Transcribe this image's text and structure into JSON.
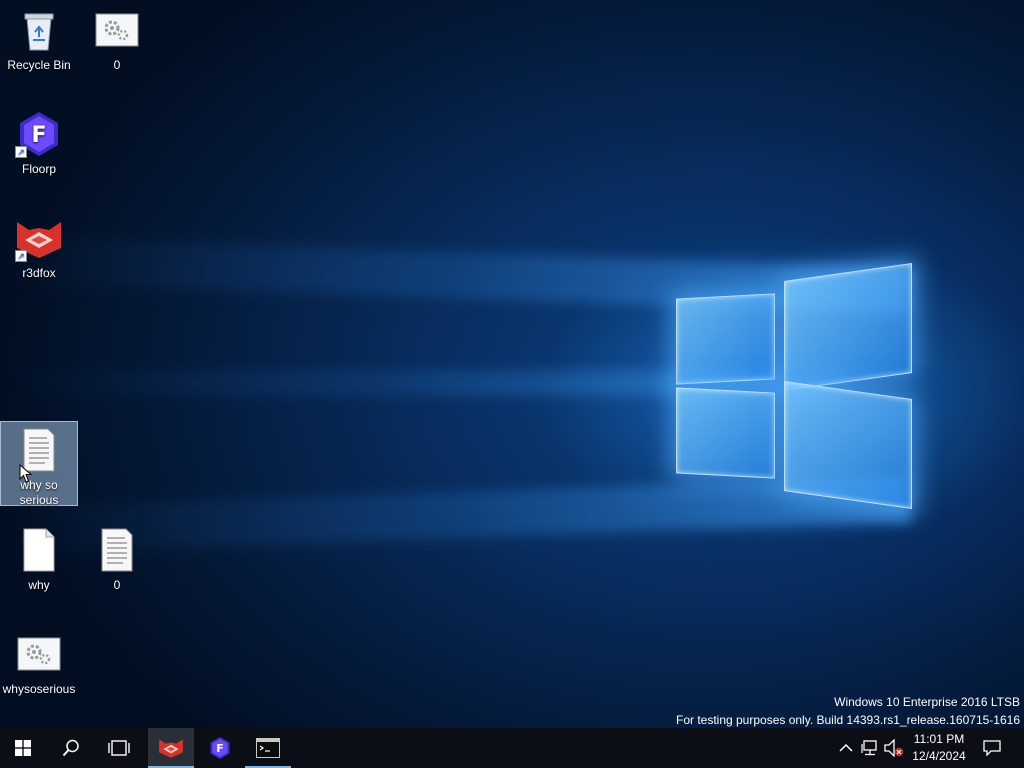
{
  "desktop": {
    "icons": [
      {
        "label": "Recycle Bin",
        "icon": "recycle-bin-icon"
      },
      {
        "label": "0",
        "icon": "settings-file-icon"
      },
      {
        "label": "Floorp",
        "icon": "floorp-icon",
        "shortcut": true
      },
      {
        "label": "r3dfox",
        "icon": "r3dfox-icon",
        "shortcut": true
      },
      {
        "label": "why so serious",
        "icon": "text-document-icon",
        "selected": true
      },
      {
        "label": "why",
        "icon": "blank-file-icon"
      },
      {
        "label": "0",
        "icon": "text-document-icon"
      },
      {
        "label": "whysoserious",
        "icon": "settings-file-icon"
      }
    ],
    "watermark": {
      "line1": "Windows 10 Enterprise 2016 LTSB",
      "line2": "For testing purposes only. Build 14393.rs1_release.160715-1616"
    }
  },
  "taskbar": {
    "start": "start-windows-icon",
    "search": "search-icon",
    "task_view": "task-view-icon",
    "pinned": [
      {
        "name": "r3dfox",
        "icon": "r3dfox-icon",
        "active": true
      },
      {
        "name": "Floorp",
        "icon": "floorp-icon",
        "active": false
      },
      {
        "name": "Command Prompt",
        "icon": "command-prompt-icon",
        "running": true
      }
    ],
    "tray": {
      "show_hidden": "chevron-up-icon",
      "network": "network-icon",
      "volume": "volume-muted-icon",
      "time": "11:01 PM",
      "date": "12/4/2024",
      "notifications": "action-center-icon"
    }
  },
  "colors": {
    "taskbar_bg": "#0b0f15",
    "accent": "#7fb5e6",
    "selection": "#a0bedc"
  }
}
